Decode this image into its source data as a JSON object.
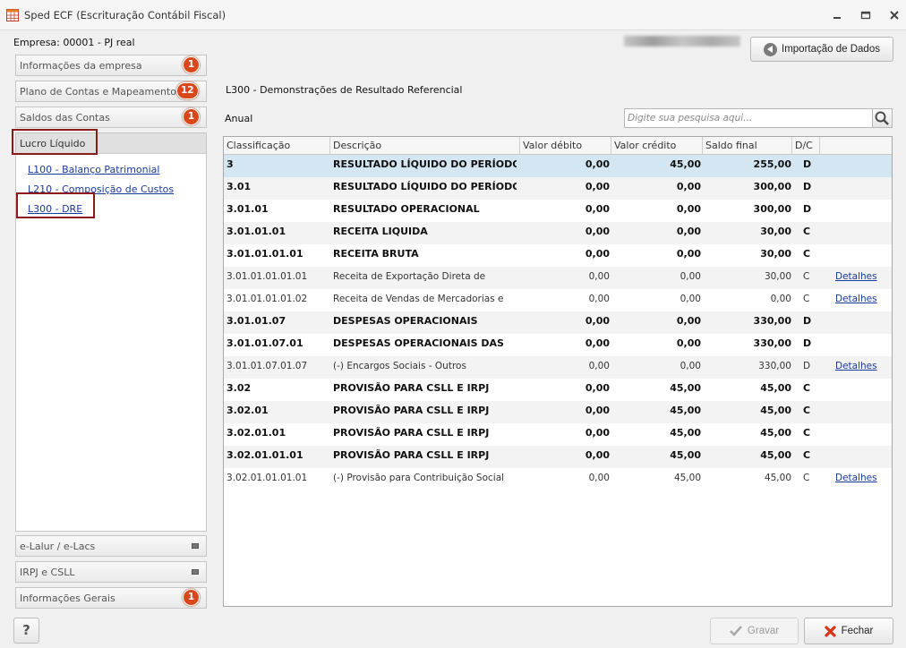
{
  "window": {
    "title": "Sped ECF (Escrituração Contábil Fiscal)"
  },
  "company": {
    "label": "Empresa: 00001 - PJ real"
  },
  "import_button": {
    "label": "Importação de Dados"
  },
  "nav": {
    "items": [
      {
        "label": "Informações da empresa",
        "badge": "1"
      },
      {
        "label": "Plano de Contas e Mapeamento",
        "badge": "12"
      },
      {
        "label": "Saldos das Contas",
        "badge": "1"
      }
    ],
    "active_panel": {
      "label": "Lucro Líquido",
      "links": [
        "L100 - Balanço Patrimonial",
        "L210 - Composição de Custos",
        "L300 - DRE"
      ]
    },
    "bottom_items": [
      {
        "label": "e-Lalur / e-Lacs",
        "badge": ""
      },
      {
        "label": "IRPJ e CSLL",
        "badge": ""
      },
      {
        "label": "Informações Gerais",
        "badge": "1"
      }
    ]
  },
  "help_button": {
    "label": "?"
  },
  "section": {
    "title": "L300 - Demonstrações de Resultado Referencial",
    "period": "Anual"
  },
  "search": {
    "placeholder": "Digite sua pesquisa aqui..."
  },
  "table": {
    "columns": [
      "Classificação",
      "Descrição",
      "Valor débito",
      "Valor crédito",
      "Saldo final",
      "D/C",
      ""
    ],
    "rows": [
      {
        "cls": "3",
        "desc": "RESULTADO LÍQUIDO DO PERÍODO",
        "deb": "0,00",
        "cred": "45,00",
        "saldo": "255,00",
        "dc": "D",
        "det": "",
        "bold": true
      },
      {
        "cls": "3.01",
        "desc": "RESULTADO LÍQUIDO DO PERÍODO",
        "deb": "0,00",
        "cred": "0,00",
        "saldo": "300,00",
        "dc": "D",
        "det": "",
        "bold": true
      },
      {
        "cls": "3.01.01",
        "desc": "RESULTADO OPERACIONAL",
        "deb": "0,00",
        "cred": "0,00",
        "saldo": "300,00",
        "dc": "D",
        "det": "",
        "bold": true
      },
      {
        "cls": "3.01.01.01",
        "desc": "RECEITA LIQUIDA",
        "deb": "0,00",
        "cred": "0,00",
        "saldo": "30,00",
        "dc": "C",
        "det": "",
        "bold": true
      },
      {
        "cls": "3.01.01.01.01",
        "desc": "RECEITA BRUTA",
        "deb": "0,00",
        "cred": "0,00",
        "saldo": "30,00",
        "dc": "C",
        "det": "",
        "bold": true
      },
      {
        "cls": "3.01.01.01.01.01",
        "desc": "Receita de Exportação Direta de",
        "deb": "0,00",
        "cred": "0,00",
        "saldo": "30,00",
        "dc": "C",
        "det": "Detalhes",
        "bold": false
      },
      {
        "cls": "3.01.01.01.01.02",
        "desc": "Receita de Vendas de Mercadorias e",
        "deb": "0,00",
        "cred": "0,00",
        "saldo": "0,00",
        "dc": "C",
        "det": "Detalhes",
        "bold": false
      },
      {
        "cls": "3.01.01.07",
        "desc": "DESPESAS OPERACIONAIS",
        "deb": "0,00",
        "cred": "0,00",
        "saldo": "330,00",
        "dc": "D",
        "det": "",
        "bold": true
      },
      {
        "cls": "3.01.01.07.01",
        "desc": "DESPESAS OPERACIONAIS DAS",
        "deb": "0,00",
        "cred": "0,00",
        "saldo": "330,00",
        "dc": "D",
        "det": "",
        "bold": true
      },
      {
        "cls": "3.01.01.07.01.07",
        "desc": "(-) Encargos Sociais - Outros",
        "deb": "0,00",
        "cred": "0,00",
        "saldo": "330,00",
        "dc": "D",
        "det": "Detalhes",
        "bold": false
      },
      {
        "cls": "3.02",
        "desc": "PROVISÃO PARA CSLL E IRPJ",
        "deb": "0,00",
        "cred": "45,00",
        "saldo": "45,00",
        "dc": "C",
        "det": "",
        "bold": true
      },
      {
        "cls": "3.02.01",
        "desc": "PROVISÃO PARA CSLL E IRPJ",
        "deb": "0,00",
        "cred": "45,00",
        "saldo": "45,00",
        "dc": "C",
        "det": "",
        "bold": true
      },
      {
        "cls": "3.02.01.01",
        "desc": "PROVISÃO PARA CSLL E IRPJ",
        "deb": "0,00",
        "cred": "45,00",
        "saldo": "45,00",
        "dc": "C",
        "det": "",
        "bold": true
      },
      {
        "cls": "3.02.01.01.01",
        "desc": "PROVISÃO PARA CSLL E IRPJ",
        "deb": "0,00",
        "cred": "45,00",
        "saldo": "45,00",
        "dc": "C",
        "det": "",
        "bold": true
      },
      {
        "cls": "3.02.01.01.01.01",
        "desc": "(-) Provisão para Contribuição Social",
        "deb": "0,00",
        "cred": "45,00",
        "saldo": "45,00",
        "dc": "C",
        "det": "Detalhes",
        "bold": false
      }
    ]
  },
  "footer": {
    "save_label": "Gravar",
    "close_label": "Fechar"
  },
  "colors": {
    "badge": "#d9481a",
    "highlight": "#8b1a1a",
    "selected_row": "#d5e6f3",
    "link": "#1a3a9a"
  }
}
